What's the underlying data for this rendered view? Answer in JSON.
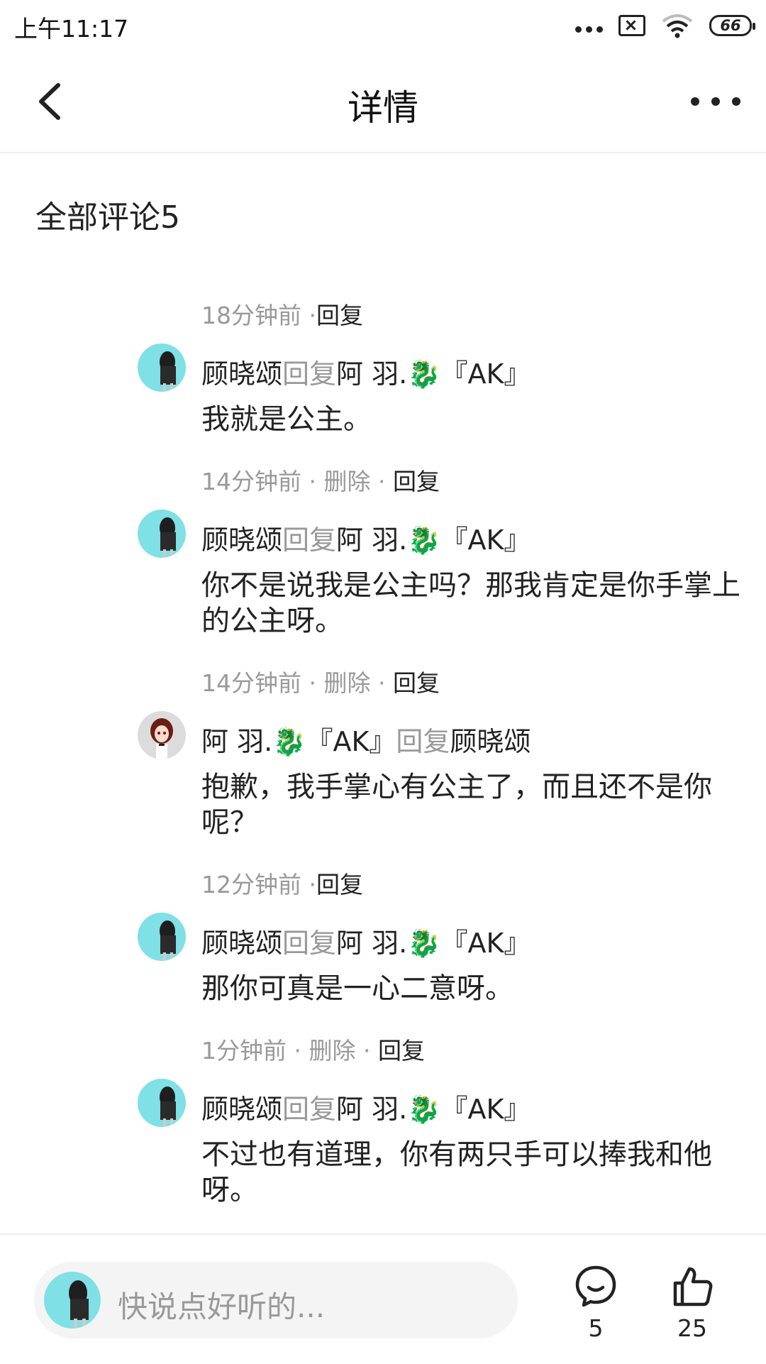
{
  "status_bar": {
    "time": "上午11:17",
    "battery": "66"
  },
  "header": {
    "title": "详情"
  },
  "section_title": "全部评论5",
  "comments": [
    {
      "time": "18分钟前",
      "sep": " ·",
      "actions": [
        "回复"
      ],
      "author": "顾晓颂",
      "reply_word": "回复",
      "target": "阿  羽.🐉『AK』",
      "text": "我就是公主。"
    },
    {
      "time": "14分钟前",
      "sep": " · ",
      "actions": [
        "删除",
        "回复"
      ],
      "author": "顾晓颂",
      "reply_word": "回复",
      "target": "阿  羽.🐉『AK』",
      "text": "你不是说我是公主吗？那我肯定是你手掌上的公主呀。"
    },
    {
      "time": "14分钟前",
      "sep": " · ",
      "actions": [
        "删除",
        "回复"
      ],
      "author": "阿  羽.🐉『AK』",
      "reply_word": "回复",
      "target": "顾晓颂",
      "text": "抱歉，我手掌心有公主了，而且还不是你呢？"
    },
    {
      "time": "12分钟前",
      "sep": " ·",
      "actions": [
        "回复"
      ],
      "author": "顾晓颂",
      "reply_word": "回复",
      "target": "阿  羽.🐉『AK』",
      "text": "那你可真是一心二意呀。"
    },
    {
      "time": "1分钟前",
      "sep": " · ",
      "actions": [
        "删除",
        "回复"
      ],
      "author": "顾晓颂",
      "reply_word": "回复",
      "target": "阿  羽.🐉『AK』",
      "text": "不过也有道理，你有两只手可以捧我和他呀。"
    }
  ],
  "bottom_bar": {
    "placeholder": "快说点好听的...",
    "comment_count": "5",
    "like_count": "25"
  },
  "colors": {
    "muted": "#999999",
    "avatar_bg": "#7fe0e6"
  },
  "icons": [
    "back-arrow-icon",
    "more-dots-icon",
    "comment-bubble-icon",
    "thumbs-up-icon"
  ]
}
